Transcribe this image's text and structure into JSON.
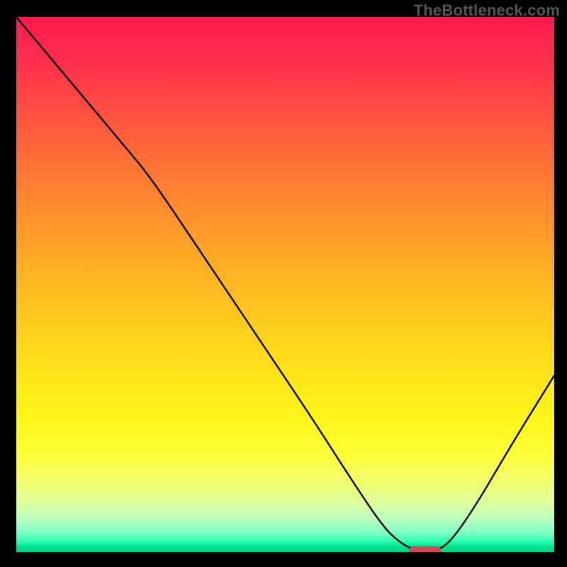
{
  "watermark": "TheBottleneck.com",
  "chart_data": {
    "type": "line",
    "title": "",
    "xlabel": "",
    "ylabel": "",
    "xlim": [
      0,
      100
    ],
    "ylim": [
      0,
      100
    ],
    "grid": false,
    "legend": false,
    "series": [
      {
        "name": "bottleneck-curve",
        "x": [
          0,
          10,
          20,
          25,
          35,
          45,
          55,
          62,
          68,
          71,
          74,
          77,
          80,
          85,
          92,
          100
        ],
        "y": [
          100,
          88,
          76,
          70,
          55,
          40,
          25,
          14,
          5,
          2,
          0.3,
          0.3,
          1,
          8,
          20,
          33
        ]
      }
    ],
    "marker": {
      "name": "optimal-point",
      "x_start": 73,
      "x_end": 79,
      "y": 0.3,
      "color": "#d14b55"
    },
    "gradient_meaning": "background hue from red (high bottleneck) at top to green (low bottleneck) at bottom"
  }
}
